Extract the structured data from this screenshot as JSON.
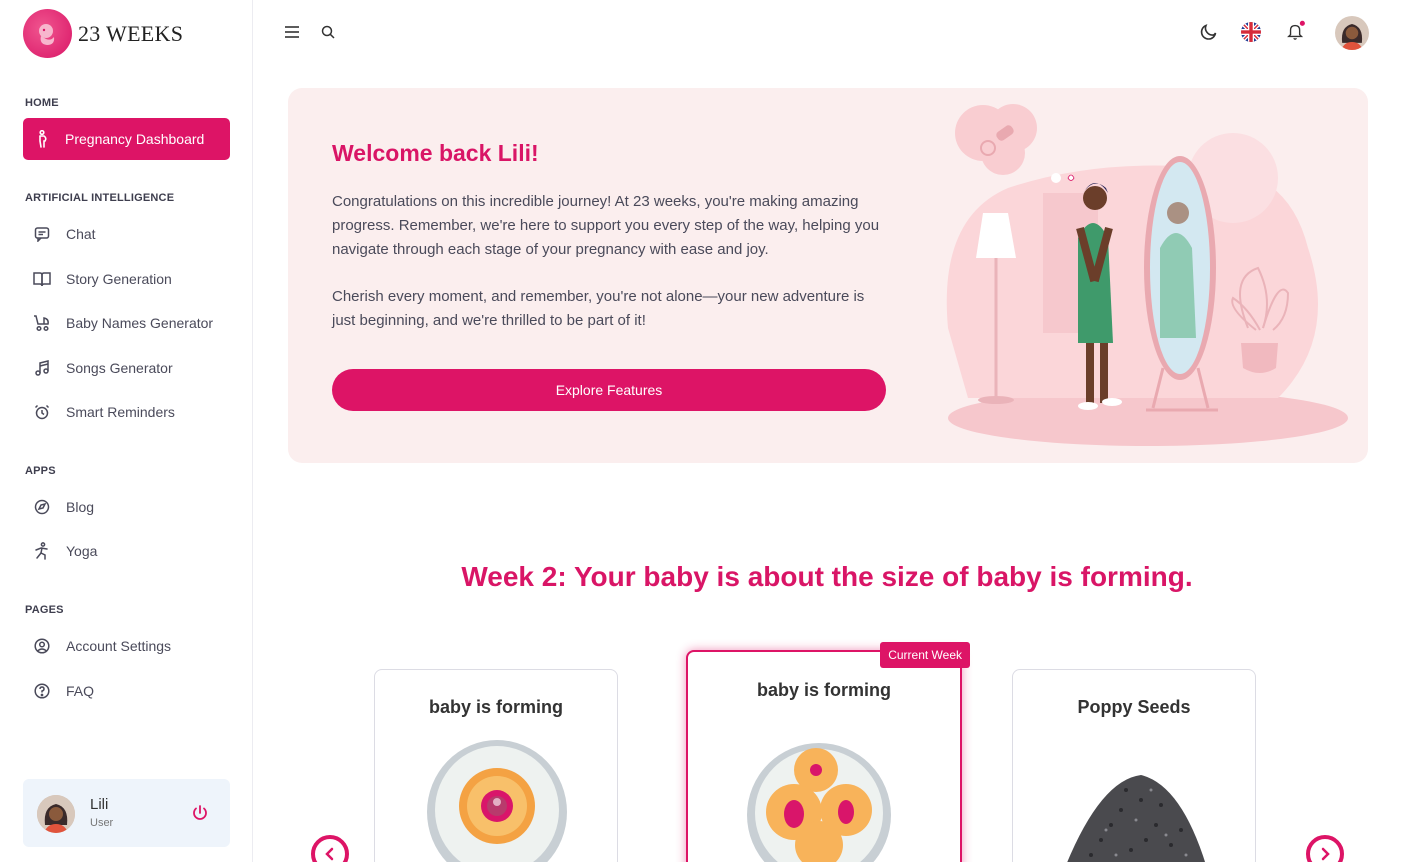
{
  "brand": {
    "name": "23 WEEKS",
    "logo_icon": "fetus-icon",
    "accent": "#dd1466"
  },
  "sidebar": {
    "sections": {
      "home": "HOME",
      "ai": "ARTIFICIAL INTELLIGENCE",
      "apps": "APPS",
      "pages": "PAGES"
    },
    "active_item": {
      "label": "Pregnancy Dashboard",
      "icon": "pregnant-woman-icon"
    },
    "ai_items": [
      {
        "label": "Chat",
        "icon": "chat-icon"
      },
      {
        "label": "Story Generation",
        "icon": "book-icon"
      },
      {
        "label": "Baby Names Generator",
        "icon": "stroller-icon"
      },
      {
        "label": "Songs Generator",
        "icon": "music-note-icon"
      },
      {
        "label": "Smart Reminders",
        "icon": "alarm-clock-icon"
      }
    ],
    "app_items": [
      {
        "label": "Blog",
        "icon": "blog-icon"
      },
      {
        "label": "Yoga",
        "icon": "yoga-icon"
      }
    ],
    "page_items": [
      {
        "label": "Account Settings",
        "icon": "user-circle-icon"
      },
      {
        "label": "FAQ",
        "icon": "help-circle-icon"
      }
    ],
    "user": {
      "name": "Lili",
      "role": "User"
    }
  },
  "topbar": {
    "icons": [
      "menu-icon",
      "search-icon",
      "moon-icon",
      "uk-flag-icon",
      "bell-icon",
      "avatar"
    ]
  },
  "hero": {
    "title": "Welcome back Lili!",
    "paragraph1": "Congratulations on this incredible journey! At 23 weeks, you're making amazing progress. Remember, we're here to support you every step of the way, helping you navigate through each stage of your pregnancy with ease and joy.",
    "paragraph2": "Cherish every moment, and remember, you're not alone—your new adventure is just beginning, and we're thrilled to be part of it!",
    "button": "Explore Features"
  },
  "week": {
    "heading": "Week 2: Your baby is about the size of baby is forming.",
    "cards": [
      {
        "title": "baby is forming"
      },
      {
        "title": "baby is forming",
        "badge": "Current Week"
      },
      {
        "title": "Poppy Seeds"
      }
    ]
  }
}
